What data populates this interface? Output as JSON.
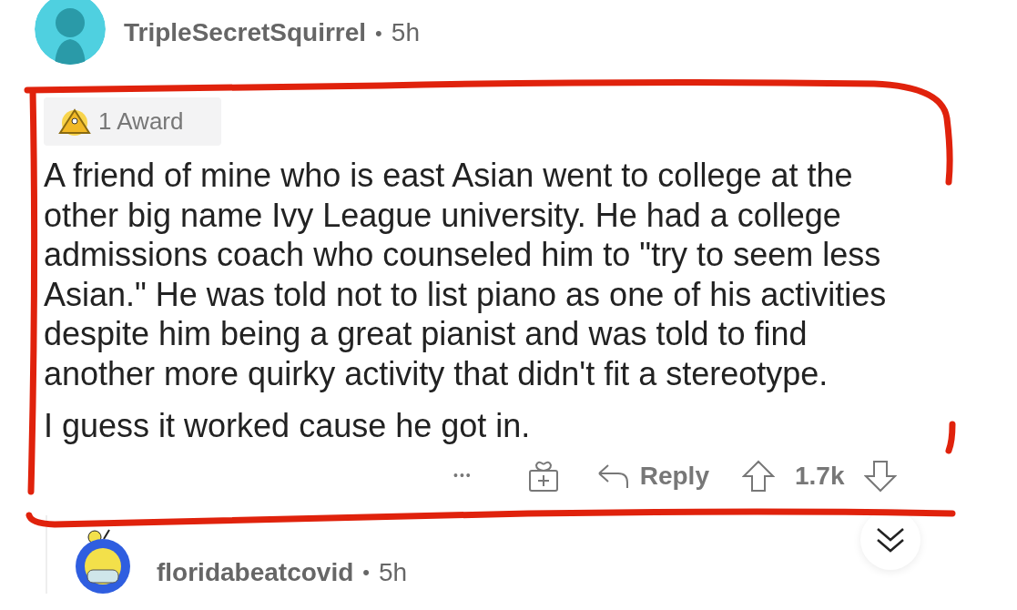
{
  "comment": {
    "author": "TripleSecretSquirrel",
    "separator": "•",
    "time": "5h",
    "award": {
      "label": "1 Award"
    },
    "paragraphs": [
      "A friend of mine who is east Asian went to college at the other big name Ivy League university. He had a college admissions coach who counseled him to \"try to seem less Asian.\" He was told not to list piano as one of his activities despite him being a great pianist and was told to find another more quirky activity that didn't fit a stereotype.",
      "I guess it worked cause he got in."
    ],
    "actions": {
      "more": "•••",
      "reply": "Reply",
      "votes": "1.7k"
    }
  },
  "reply": {
    "author": "floridabeatcovid",
    "separator": "•",
    "time": "5h"
  }
}
